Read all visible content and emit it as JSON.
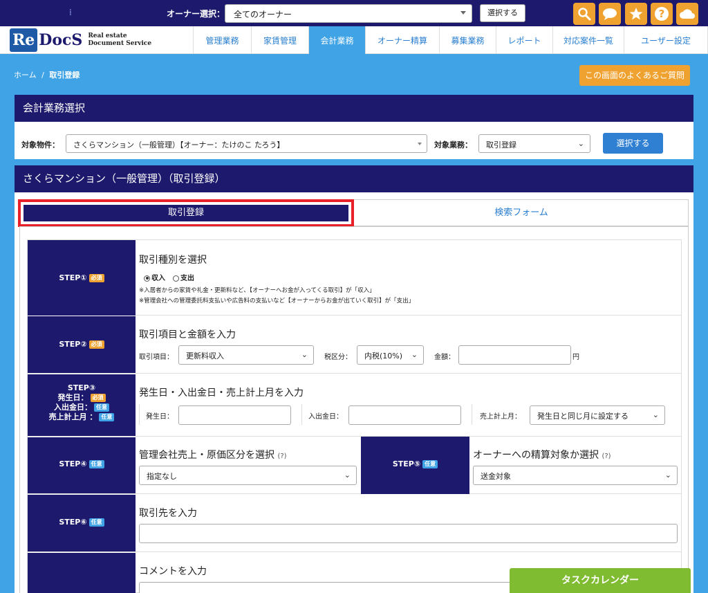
{
  "topbar": {
    "mark": "⁞",
    "owner_label": "オーナー選択：",
    "owner_value": "全てのオーナー",
    "select_button": "選択する",
    "icons": [
      "search-icon",
      "chat-icon",
      "star-icon",
      "help-icon",
      "cloud-icon"
    ],
    "icon_glyphs": {
      "help": "?"
    }
  },
  "logo": {
    "re": "Re",
    "docs": "DocS",
    "sub1": "Real estate",
    "sub2": "Document Service"
  },
  "nav": {
    "items": [
      {
        "label": "管理業務"
      },
      {
        "label": "家賃管理"
      },
      {
        "label": "会計業務"
      },
      {
        "label": "オーナー精算"
      },
      {
        "label": "募集業務"
      },
      {
        "label": "レポート"
      },
      {
        "label": "対応案件一覧"
      },
      {
        "label": "ユーザー設定"
      }
    ]
  },
  "breadcrumb": {
    "home": "ホーム",
    "sep": "/",
    "current": "取引登録"
  },
  "faq_button": "この画面のよくあるご質問",
  "panel1": {
    "title": "会計業務選択",
    "property_label": "対象物件：",
    "property_value": "さくらマンション（一般管理）【オーナー：たけのこ たろう】",
    "task_label": "対象業務：",
    "task_value": "取引登録",
    "select_button": "選択する"
  },
  "panel2": {
    "title": "さくらマンション（一般管理）（取引登録）",
    "tab_register": "取引登録",
    "tab_search": "検索フォーム"
  },
  "badges": {
    "required": "必須",
    "optional": "任意"
  },
  "steps": {
    "s1": {
      "label": "STEP①",
      "title": "取引種別を選択",
      "radio_income": "収入",
      "radio_expense": "支出",
      "note1": "※入居者からの家賃や礼金・更新料など、【オーナーへお金が入ってくる取引】が「収入」",
      "note2": "※管理会社への管理委託料支払いや広告料の支払いなど【オーナーからお金が出ていく取引】が「支出」"
    },
    "s2": {
      "label": "STEP②",
      "title": "取引項目と金額を入力",
      "item_label": "取引項目：",
      "item_value": "更新料収入",
      "tax_label": "税区分：",
      "tax_value": "内税(10%)",
      "amount_label": "金額：",
      "amount_unit": "円"
    },
    "s3": {
      "label": "STEP③",
      "sub1": "発生日：",
      "sub2": "入出金日：",
      "sub3": "売上計上月 ：",
      "title": "発生日・入出金日・売上計上月を入力",
      "date_label": "発生日：",
      "inout_label": "入出金日：",
      "month_label": "売上計上月：",
      "month_value": "発生日と同じ月に設定する"
    },
    "s4": {
      "label": "STEP④",
      "title": "管理会社売上・原価区分を選択",
      "hint": "(?)",
      "value": "指定なし"
    },
    "s5": {
      "label": "STEP⑤",
      "title": "オーナーへの精算対象か選択",
      "hint": "(?)",
      "value": "送金対象"
    },
    "s6": {
      "label": "STEP⑥",
      "title": "取引先を入力"
    },
    "s7": {
      "title": "コメントを入力"
    }
  },
  "task_calendar": "タスクカレンダー"
}
